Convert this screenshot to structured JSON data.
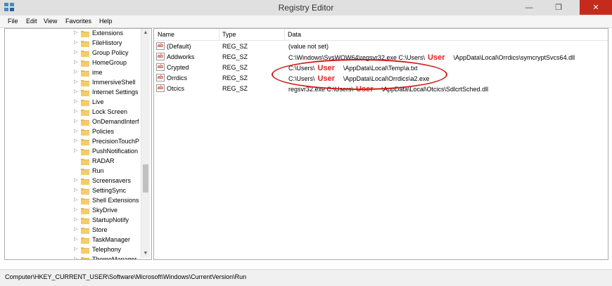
{
  "window": {
    "title": "Registry Editor",
    "minimize": "—",
    "restore": "❐",
    "close": "✕"
  },
  "menu": {
    "items": [
      "File",
      "Edit",
      "View",
      "Favorites",
      "Help"
    ]
  },
  "tree": {
    "items": [
      {
        "label": "Extensions"
      },
      {
        "label": "FileHistory"
      },
      {
        "label": "Group Policy"
      },
      {
        "label": "HomeGroup"
      },
      {
        "label": "ime"
      },
      {
        "label": "ImmersiveShell"
      },
      {
        "label": "Internet Settings"
      },
      {
        "label": "Live"
      },
      {
        "label": "Lock Screen"
      },
      {
        "label": "OnDemandInterf"
      },
      {
        "label": "Policies"
      },
      {
        "label": "PrecisionTouchP"
      },
      {
        "label": "PushNotification"
      },
      {
        "label": "RADAR"
      },
      {
        "label": "Run"
      },
      {
        "label": "Screensavers"
      },
      {
        "label": "SettingSync"
      },
      {
        "label": "Shell Extensions"
      },
      {
        "label": "SkyDrive"
      },
      {
        "label": "StartupNotify"
      },
      {
        "label": "Store"
      },
      {
        "label": "TaskManager"
      },
      {
        "label": "Telephony"
      },
      {
        "label": "ThemeManager"
      }
    ]
  },
  "list": {
    "columns": {
      "name": "Name",
      "type": "Type",
      "data": "Data"
    },
    "rows": [
      {
        "name": "(Default)",
        "type": "REG_SZ",
        "data_pre": "(value not set)",
        "user": "",
        "data_post": ""
      },
      {
        "name": "Addworks",
        "type": "REG_SZ",
        "data_pre": "C:\\Windows\\SysWOW64\\regsvr32.exe C:\\Users\\",
        "user": "User",
        "data_post": "\\AppData\\Local\\Orrdics\\symcryptSvcs64.dll"
      },
      {
        "name": "Crypted",
        "type": "REG_SZ",
        "data_pre": "C:\\Users\\",
        "user": "User",
        "data_post": "\\AppData\\Local\\Temp\\a.txt"
      },
      {
        "name": "Orrdics",
        "type": "REG_SZ",
        "data_pre": "C:\\Users\\",
        "user": "User",
        "data_post": "\\AppData\\Local\\Orrdics\\a2.exe"
      },
      {
        "name": "Otcics",
        "type": "REG_SZ",
        "data_pre": "regsvr32.exe C:\\Users\\",
        "user": "User",
        "data_post": "\\AppData\\Local\\Otcics\\SdlcrtSched.dll"
      }
    ]
  },
  "status": {
    "path": "Computer\\HKEY_CURRENT_USER\\Software\\Microsoft\\Windows\\CurrentVersion\\Run"
  },
  "icons": {
    "app": "registry-icon",
    "folder": "folder-icon",
    "value": "string-value-icon",
    "expander": "expander-icon"
  },
  "colors": {
    "annotation": "#e41e1e",
    "folder": "#e8b64a",
    "close_button": "#c42b1c"
  }
}
